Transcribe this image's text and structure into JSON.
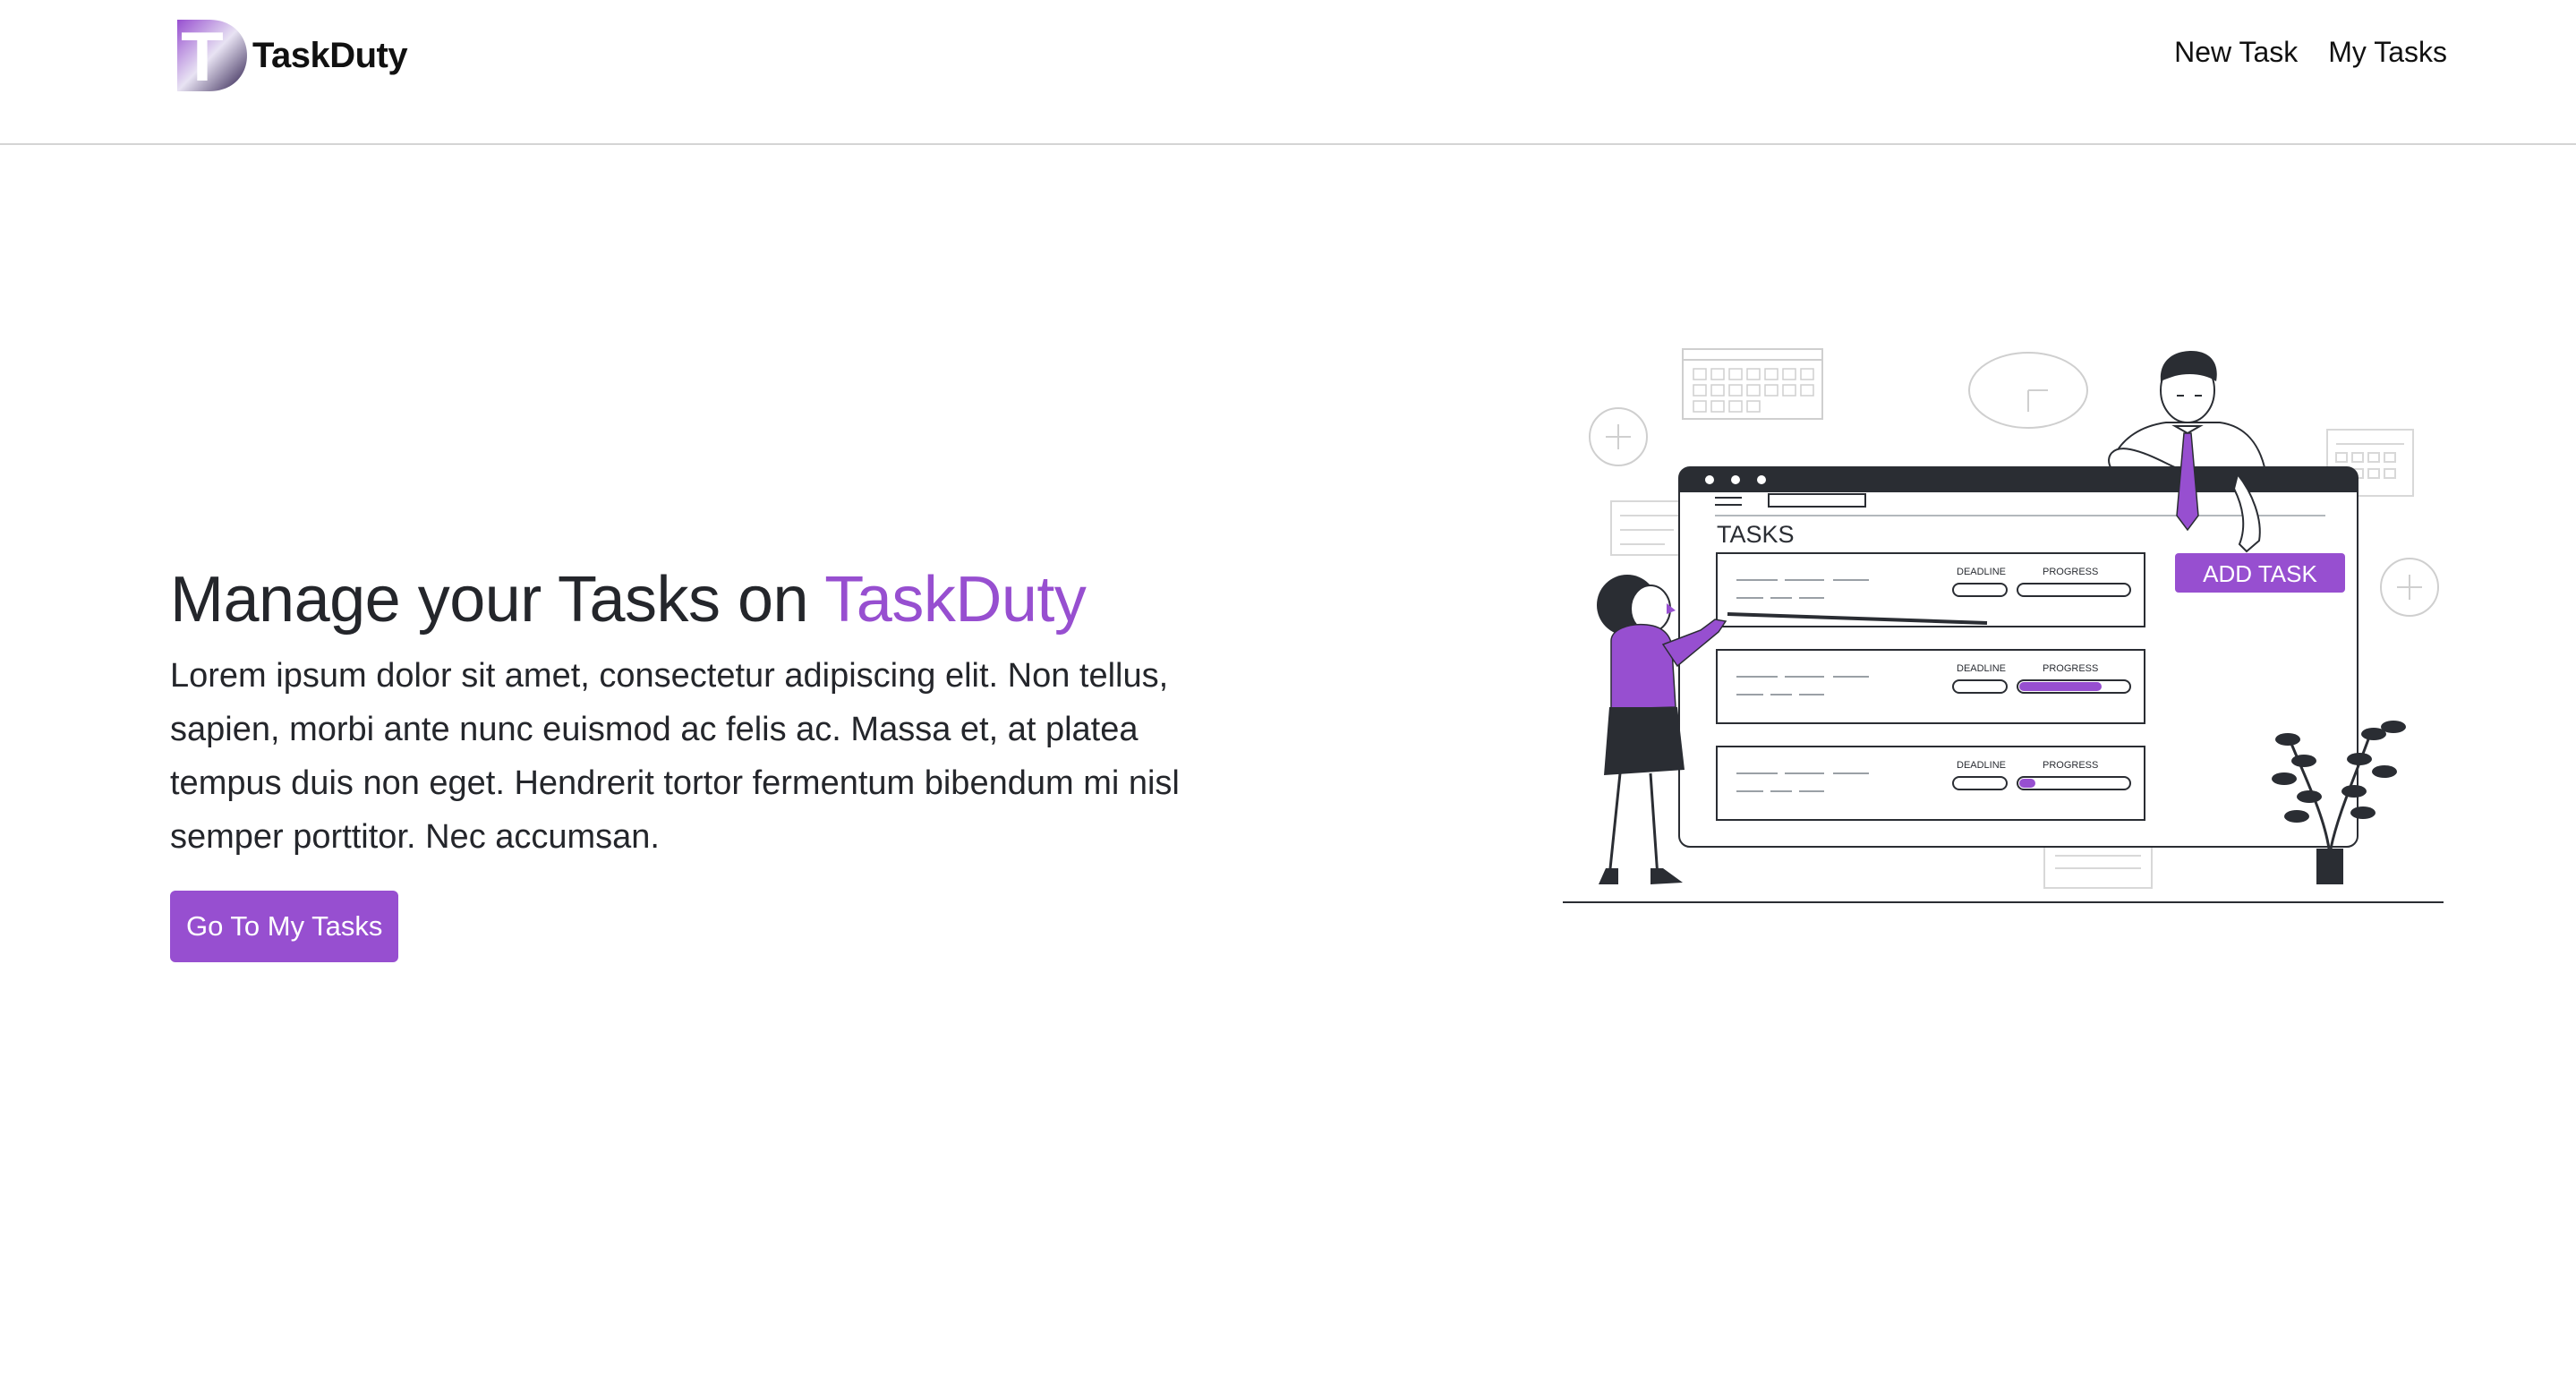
{
  "header": {
    "logo_text": "TaskDuty",
    "logo_letter": "T",
    "nav": {
      "new_task": "New Task",
      "my_tasks": "My Tasks"
    }
  },
  "hero": {
    "title_prefix": "Manage your Tasks on ",
    "title_brand": "TaskDuty",
    "description": "Lorem ipsum dolor sit amet, consectetur adipiscing elit. Non tellus, sapien, morbi ante nunc euismod ac felis ac. Massa et, at platea tempus duis non eget. Hendrerit tortor fermentum bibendum mi nisl semper porttitor. Nec accumsan.",
    "cta_label": "Go To My Tasks"
  },
  "illustration": {
    "board_title": "TASKS",
    "add_task_label": "ADD TASK",
    "deadline_label": "DEADLINE",
    "progress_label": "PROGRESS",
    "task_progress": [
      0,
      0.75,
      0.15
    ]
  },
  "colors": {
    "accent": "#974fd0",
    "text": "#24262b",
    "border": "#d4d4d4"
  }
}
